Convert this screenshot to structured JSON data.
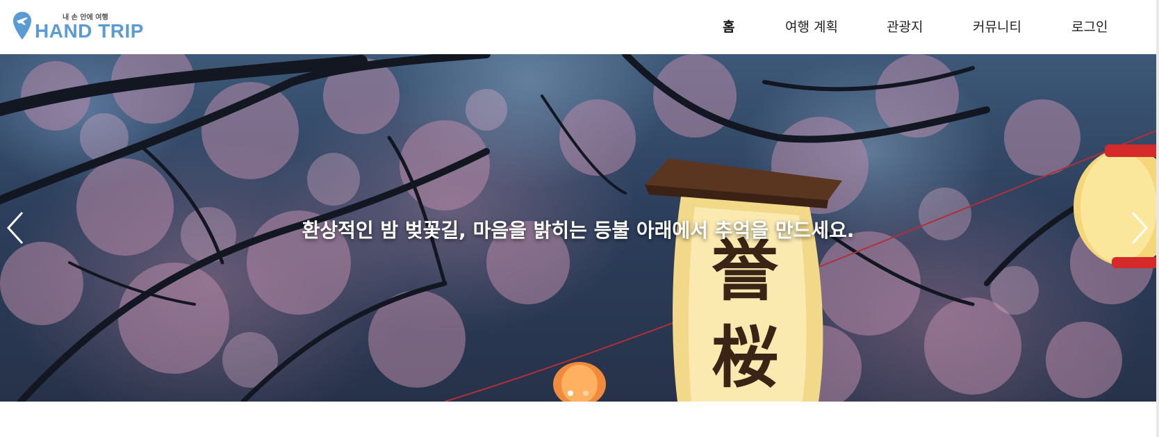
{
  "brand": {
    "tagline": "내 손 안에 여행",
    "name": "HAND TRIP",
    "logo_icon": "map-pin-airplane-icon",
    "color": "#5b9bd5"
  },
  "nav": {
    "items": [
      {
        "label": "홈",
        "active": true
      },
      {
        "label": "여행 계획",
        "active": false
      },
      {
        "label": "관광지",
        "active": false
      },
      {
        "label": "커뮤니티",
        "active": false
      },
      {
        "label": "로그인",
        "active": false
      }
    ]
  },
  "hero": {
    "caption": "환상적인 밤 벚꽃길, 마음을 밝히는 등불 아래에서 추억을 만드세요.",
    "lantern_text": [
      "誉",
      "桜"
    ],
    "prev_icon": "chevron-left-icon",
    "next_icon": "chevron-right-icon",
    "slide_count": 2,
    "active_slide": 1
  }
}
